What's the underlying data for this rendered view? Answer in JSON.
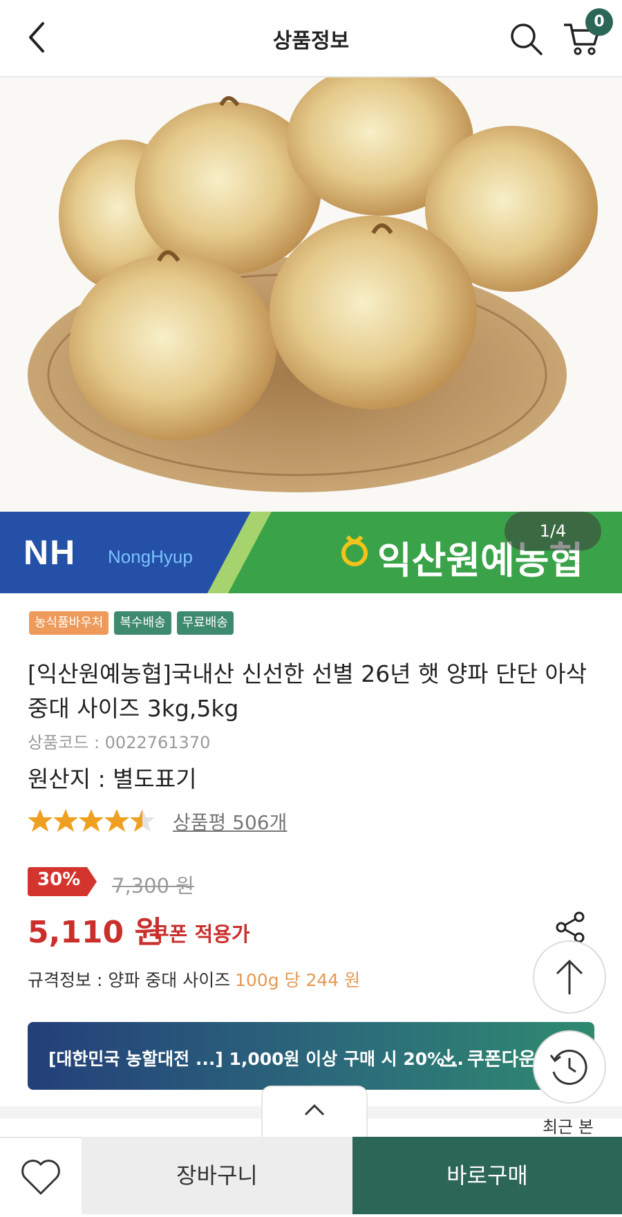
{
  "header": {
    "title": "상품정보",
    "back_icon": "chevron-left-icon",
    "search_icon": "search-icon",
    "cart_icon": "cart-icon",
    "cart_count": "0"
  },
  "gallery": {
    "pager": "1/4",
    "banner_left_logo": "NH",
    "banner_left_sub": "NongHyup",
    "banner_right_logo": "익산원예농협"
  },
  "badges": [
    {
      "label": "농식품바우처",
      "color": "#ee9a5a"
    },
    {
      "label": "복수배송",
      "color": "#3e8a6f"
    },
    {
      "label": "무료배송",
      "color": "#3e8a6f"
    }
  ],
  "product": {
    "name": "[익산원예농협]국내산 신선한 선별 26년 햇 양파 단단 아삭 중대 사이즈 3kg,5kg",
    "code": "상품코드 : 0022761370",
    "origin": "원산지 : 별도표기",
    "rating": 4.5,
    "review_link": "상품평 506개",
    "discount": "30%",
    "original_price": "7,300 원",
    "price": "5,110 원",
    "coupon_label": "쿠폰 적용가",
    "spec": "규격정보 : 양파 중대 사이즈",
    "spec_unit": "100g 당  244 원"
  },
  "coupon": {
    "text": "[대한민국 농할대전 ...] 1,000원 이상 구매 시 20% ..",
    "download_label": "쿠폰다운"
  },
  "floating": {
    "top_icon": "arrow-up-icon",
    "recent_icon": "history-icon",
    "recent_label": "최근 본"
  },
  "bottom_bar": {
    "wishlist_icon": "heart-icon",
    "cart_label": "장바구니",
    "buy_label": "바로구매"
  },
  "colors": {
    "primary": "#2c6656",
    "price_red": "#c9302c",
    "accent_orange": "#e39a52"
  }
}
